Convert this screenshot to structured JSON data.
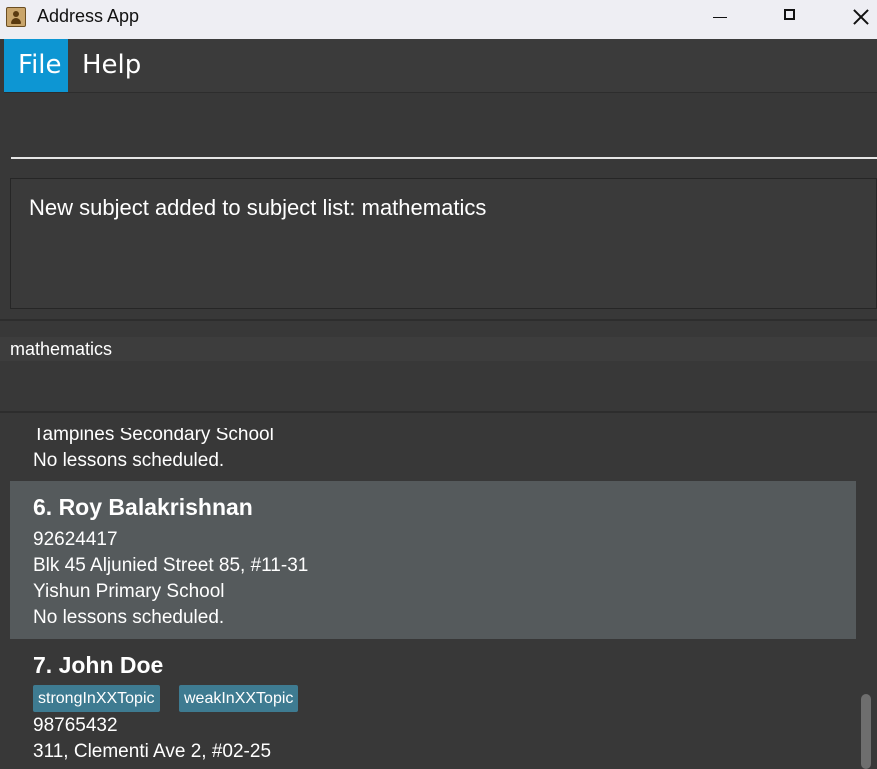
{
  "window": {
    "title": "Address App"
  },
  "menu": {
    "items": [
      "File",
      "Help"
    ]
  },
  "command": {
    "value": ""
  },
  "result": {
    "message": "New subject added to subject list: mathematics"
  },
  "subjects": [
    "mathematics"
  ],
  "persons": {
    "partial": {
      "school": "Tampines Secondary School",
      "lessons": "No lessons scheduled."
    },
    "list": [
      {
        "name": "6. Roy Balakrishnan",
        "tags": [],
        "phone": "92624417",
        "address": "Blk 45 Aljunied Street 85, #11-31",
        "school": "Yishun Primary School",
        "lessons": "No lessons scheduled."
      },
      {
        "name": "7. John Doe",
        "tags": [
          "strongInXXTopic",
          "weakInXXTopic"
        ],
        "phone": "98765432",
        "address": "311, Clementi Ave 2, #02-25"
      }
    ]
  },
  "colors": {
    "accent": "#0d96d3",
    "tag": "#3e7b91",
    "selected_card": "#555a5c",
    "background": "#383838"
  }
}
